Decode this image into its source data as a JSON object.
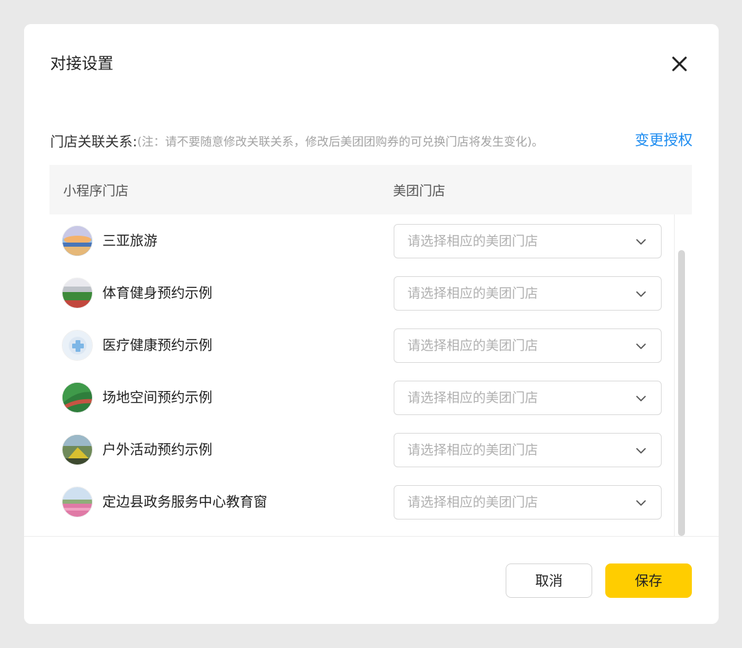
{
  "dialog": {
    "title": "对接设置",
    "close_icon": "close-icon"
  },
  "relation": {
    "label": "门店关联关系:",
    "note": "(注：请不要随意修改关联关系，修改后美团团购券的可兑换门店将发生变化)。",
    "change_auth": "变更授权"
  },
  "table": {
    "headers": [
      "小程序门店",
      "美团门店"
    ],
    "rows": [
      {
        "name": "三亚旅游",
        "avatar": "beach-sunset-avatar",
        "placeholder": "请选择相应的美团门店"
      },
      {
        "name": "体育健身预约示例",
        "avatar": "stadium-avatar",
        "placeholder": "请选择相应的美团门店"
      },
      {
        "name": "医疗健康预约示例",
        "avatar": "medical-cross-avatar",
        "placeholder": "请选择相应的美团门店"
      },
      {
        "name": "场地空间预约示例",
        "avatar": "sports-field-avatar",
        "placeholder": "请选择相应的美团门店"
      },
      {
        "name": "户外活动预约示例",
        "avatar": "camping-avatar",
        "placeholder": "请选择相应的美团门店"
      },
      {
        "name": "定边县政务服务中心教育窗",
        "avatar": "flower-field-avatar",
        "placeholder": "请选择相应的美团门店"
      }
    ]
  },
  "footer": {
    "cancel_label": "取消",
    "save_label": "保存"
  },
  "colors": {
    "accent_link": "#1b8bf0",
    "save_button": "#ffcd00",
    "header_bg": "#f6f6f6"
  }
}
